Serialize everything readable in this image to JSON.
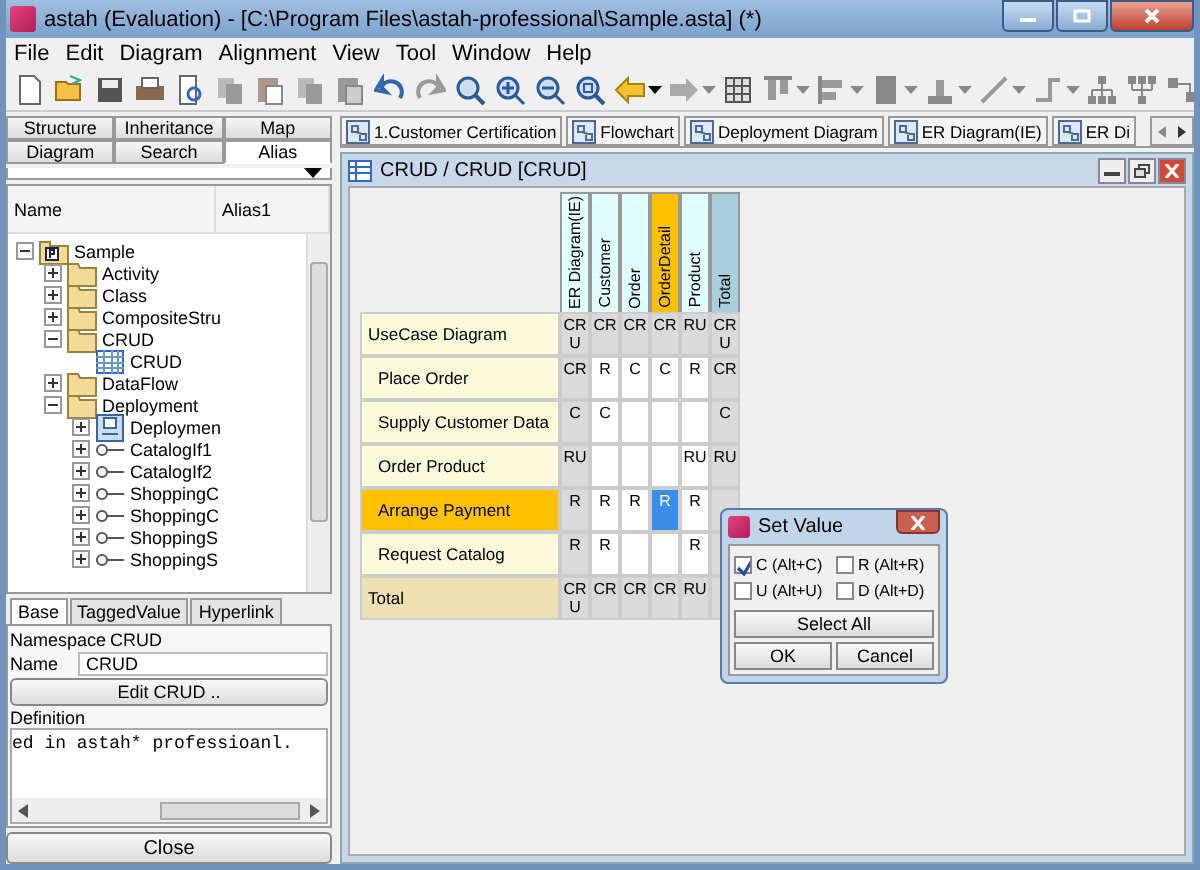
{
  "window": {
    "title": "astah (Evaluation) - [C:\\Program Files\\astah-professional\\Sample.asta] (*)"
  },
  "menu": [
    "File",
    "Edit",
    "Diagram",
    "Alignment",
    "View",
    "Tool",
    "Window",
    "Help"
  ],
  "left_tabs": [
    [
      {
        "label": "Structure",
        "selected": false
      },
      {
        "label": "Inheritance",
        "selected": false
      },
      {
        "label": "Map",
        "selected": false
      }
    ],
    [
      {
        "label": "Diagram",
        "selected": false
      },
      {
        "label": "Search",
        "selected": false
      },
      {
        "label": "Alias",
        "selected": true
      }
    ]
  ],
  "tree": {
    "columns": [
      "Name",
      "Alias1"
    ],
    "items": [
      {
        "label": "Sample",
        "kind": "project",
        "expanded": true,
        "children": [
          {
            "label": "Activity",
            "kind": "folder",
            "expanded": false
          },
          {
            "label": "Class",
            "kind": "folder",
            "expanded": false
          },
          {
            "label": "CompositeStru",
            "kind": "folder",
            "expanded": false
          },
          {
            "label": "CRUD",
            "kind": "folder",
            "expanded": true,
            "children": [
              {
                "label": "CRUD",
                "kind": "crud"
              }
            ]
          },
          {
            "label": "DataFlow",
            "kind": "folder",
            "expanded": false
          },
          {
            "label": "Deployment",
            "kind": "folder",
            "expanded": true,
            "children": [
              {
                "label": "Deploymen",
                "kind": "deployment",
                "expanded": false
              },
              {
                "label": "CatalogIf1",
                "kind": "interface",
                "expanded": false
              },
              {
                "label": "CatalogIf2",
                "kind": "interface",
                "expanded": false
              },
              {
                "label": "ShoppingC",
                "kind": "interface",
                "expanded": false
              },
              {
                "label": "ShoppingC",
                "kind": "interface",
                "expanded": false
              },
              {
                "label": "ShoppingS",
                "kind": "interface",
                "expanded": false
              },
              {
                "label": "ShoppingS",
                "kind": "interface",
                "expanded": false
              }
            ]
          }
        ]
      }
    ]
  },
  "property_tabs": [
    {
      "label": "Base",
      "selected": true
    },
    {
      "label": "TaggedValue",
      "selected": false
    },
    {
      "label": "Hyperlink",
      "selected": false
    }
  ],
  "properties": {
    "namespace_label": "Namespace",
    "namespace": "CRUD",
    "name_label": "Name",
    "name": "CRUD",
    "edit_button": "Edit CRUD ..",
    "definition_label": "Definition",
    "definition": "ed in astah* professioanl.",
    "close_button": "Close"
  },
  "diagram_tabs": [
    "1.Customer Certification",
    "Flowchart",
    "Deployment Diagram",
    "ER Diagram(IE)",
    "ER Di"
  ],
  "frame": {
    "title": "CRUD / CRUD [CRUD]"
  },
  "matrix": {
    "columns": [
      {
        "label": "ER Diagram(IE)",
        "kind": "group",
        "selected": false
      },
      {
        "label": "Customer",
        "kind": "entity",
        "selected": false
      },
      {
        "label": "Order",
        "kind": "entity",
        "selected": false
      },
      {
        "label": "OrderDetail",
        "kind": "entity",
        "selected": true
      },
      {
        "label": "Product",
        "kind": "entity",
        "selected": false
      },
      {
        "label": "Total",
        "kind": "total",
        "selected": false
      }
    ],
    "rows": [
      {
        "label": "UseCase Diagram",
        "kind": "group",
        "selected": false,
        "cells": [
          {
            "text": "CRU",
            "selected": false
          },
          {
            "text": "CR",
            "selected": false
          },
          {
            "text": "CR",
            "selected": false
          },
          {
            "text": "CR",
            "selected": false
          },
          {
            "text": "RU",
            "selected": false
          },
          {
            "text": "CRU",
            "selected": false
          }
        ]
      },
      {
        "label": "Place Order",
        "kind": "item",
        "selected": false,
        "cells": [
          {
            "text": "CR",
            "selected": false
          },
          {
            "text": "R",
            "selected": false
          },
          {
            "text": "C",
            "selected": false
          },
          {
            "text": "C",
            "selected": false
          },
          {
            "text": "R",
            "selected": false
          },
          {
            "text": "CR",
            "selected": false
          }
        ]
      },
      {
        "label": "Supply Customer Data",
        "kind": "item",
        "selected": false,
        "cells": [
          {
            "text": "C",
            "selected": false
          },
          {
            "text": "C",
            "selected": false
          },
          {
            "text": "",
            "selected": false
          },
          {
            "text": "",
            "selected": false
          },
          {
            "text": "",
            "selected": false
          },
          {
            "text": "C",
            "selected": false
          }
        ]
      },
      {
        "label": "Order Product",
        "kind": "item",
        "selected": false,
        "cells": [
          {
            "text": "RU",
            "selected": false
          },
          {
            "text": "",
            "selected": false
          },
          {
            "text": "",
            "selected": false
          },
          {
            "text": "",
            "selected": false
          },
          {
            "text": "RU",
            "selected": false
          },
          {
            "text": "RU",
            "selected": false
          }
        ]
      },
      {
        "label": "Arrange Payment",
        "kind": "item",
        "selected": true,
        "cells": [
          {
            "text": "R",
            "selected": false
          },
          {
            "text": "R",
            "selected": false
          },
          {
            "text": "R",
            "selected": false
          },
          {
            "text": "R",
            "selected": true
          },
          {
            "text": "R",
            "selected": false
          }
        ]
      },
      {
        "label": "Request Catalog",
        "kind": "item",
        "selected": false,
        "cells": [
          {
            "text": "R",
            "selected": false
          },
          {
            "text": "R",
            "selected": false
          },
          {
            "text": "",
            "selected": false
          },
          {
            "text": "",
            "selected": false
          },
          {
            "text": "R",
            "selected": false
          }
        ]
      },
      {
        "label": "Total",
        "kind": "total",
        "selected": false,
        "cells": [
          {
            "text": "CRU",
            "selected": false
          },
          {
            "text": "CR",
            "selected": false
          },
          {
            "text": "CR",
            "selected": false
          },
          {
            "text": "CR",
            "selected": false
          },
          {
            "text": "RU",
            "selected": false
          }
        ]
      }
    ]
  },
  "dialog": {
    "title": "Set Value",
    "options": [
      {
        "label": "C (Alt+C)",
        "checked": true
      },
      {
        "label": "R (Alt+R)",
        "checked": false
      },
      {
        "label": "U (Alt+U)",
        "checked": false
      },
      {
        "label": "D (Alt+D)",
        "checked": false
      }
    ],
    "select_all": "Select All",
    "ok": "OK",
    "cancel": "Cancel"
  }
}
